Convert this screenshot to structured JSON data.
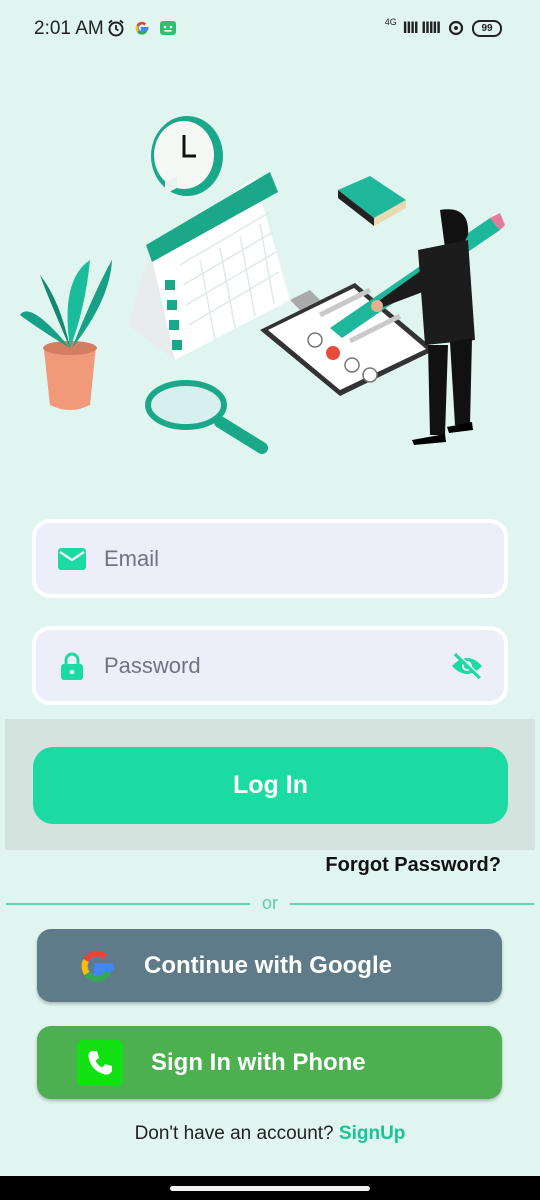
{
  "status_bar": {
    "time": "2:01 AM",
    "left_icons": [
      "alarm-icon",
      "google-icon",
      "app-notification-icon"
    ],
    "network": "4G",
    "signal": "IIII IIIII",
    "battery": "99"
  },
  "illustration": {
    "name": "schedule-planning-illustration"
  },
  "form": {
    "email_placeholder": "Email",
    "password_placeholder": "Password"
  },
  "login": {
    "button_label": "Log In",
    "forgot_label": "Forgot Password?"
  },
  "divider": {
    "text": "or"
  },
  "social": {
    "google_label": "Continue with Google",
    "phone_label": "Sign In with Phone"
  },
  "signup": {
    "prompt": "Don't have an account? ",
    "link_label": "SignUp"
  },
  "colors": {
    "background": "#e0f5ef",
    "accent": "#1bdba2",
    "google_button": "#5f7b89",
    "phone_button": "#4caf50",
    "link": "#1bc497"
  }
}
